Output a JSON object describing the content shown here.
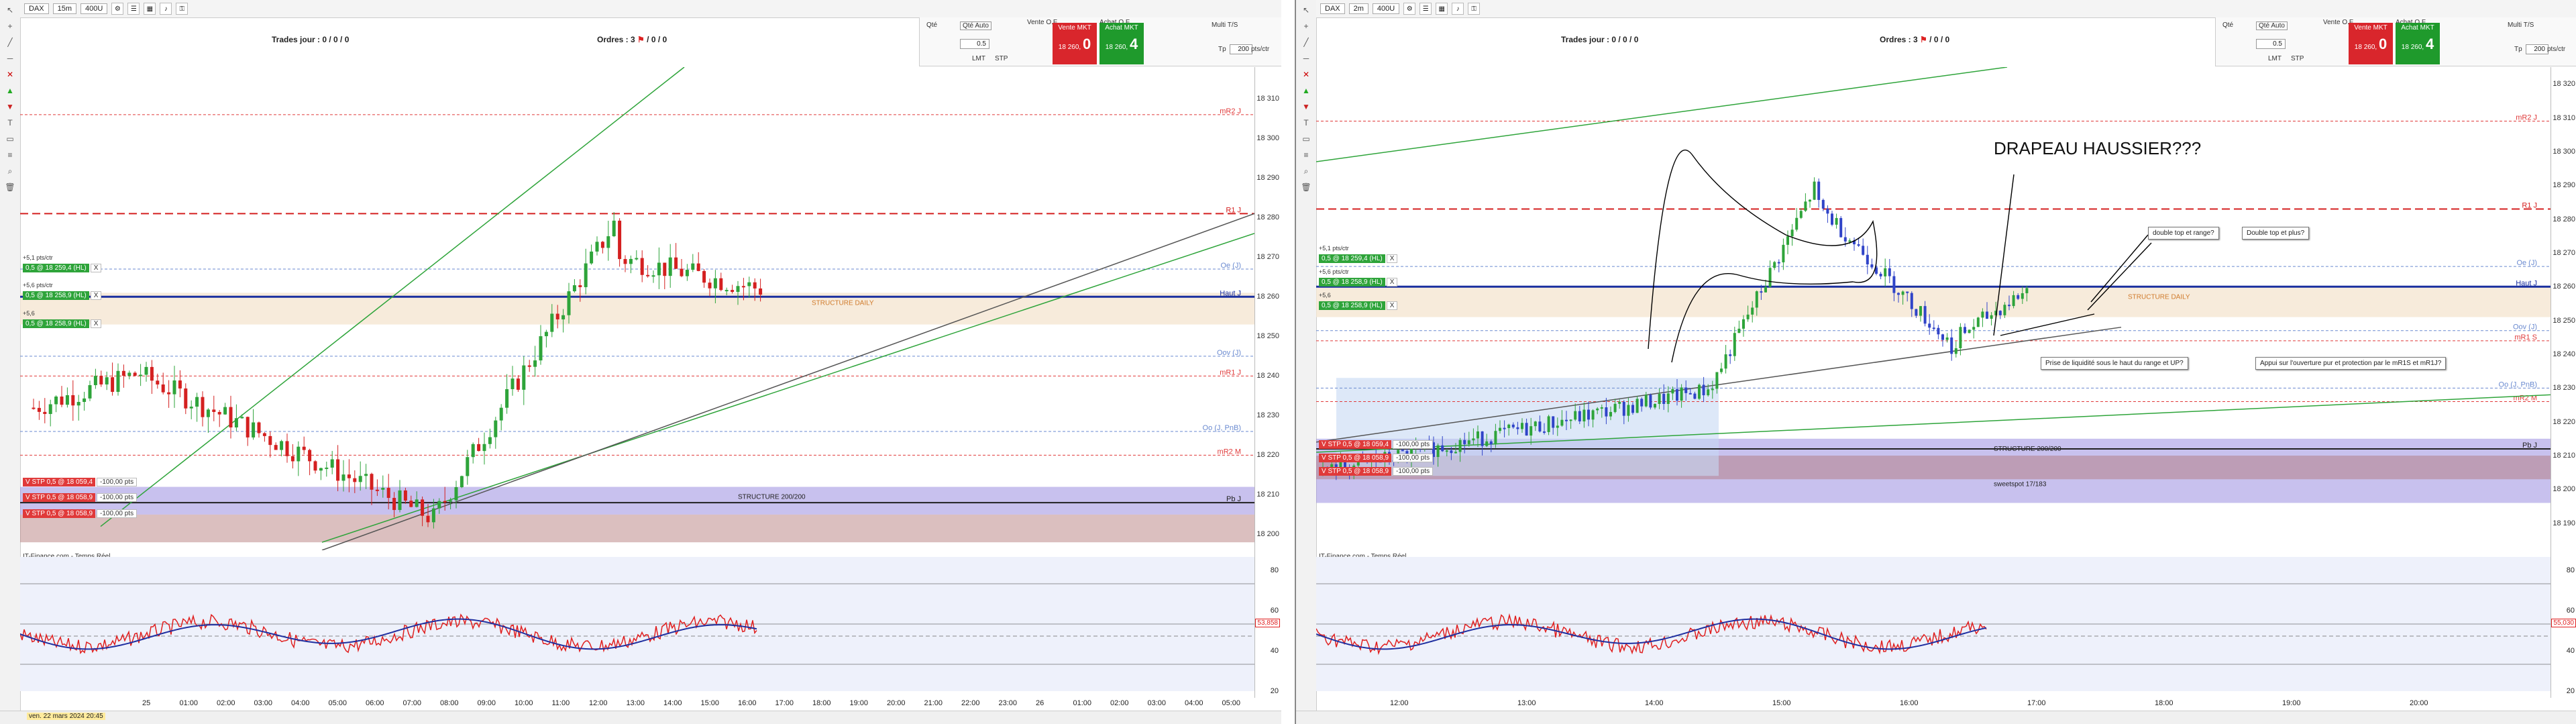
{
  "left": {
    "toolbar": {
      "symbol": "DAX",
      "timeframe": "15m",
      "ticks": "400U"
    },
    "trades_jour": "Trades jour : 0 / 0 / 0",
    "ordres": "Ordres : 3",
    "ordres_suffix": "/ 0 / 0",
    "order_panel": {
      "qty_label": "Qté",
      "qty_auto": "Qté Auto",
      "qty_value": "0.5",
      "lmt": "LMT",
      "stp": "STP",
      "vente_of": "Vente O.F.",
      "achat_of": "Achat O.F.",
      "vente_mkt": "Vente MKT",
      "achat_mkt": "Achat MKT",
      "sell_price": "18 260,",
      "sell_qty": "0",
      "buy_price": "18 260,",
      "buy_qty": "4",
      "multi_tp": "Multi T/S",
      "tp_label": "Tp",
      "tp_value": "200",
      "pts": "pts/ctr"
    },
    "price_scale": [
      "18 310",
      "18 300",
      "18 290",
      "18 280",
      "18 270",
      "18 260",
      "18 250",
      "18 240",
      "18 230",
      "18 220",
      "18 210",
      "18 200"
    ],
    "levels": {
      "mr2_j": "mR2 J",
      "r1_j": "R1 J",
      "oe_u": "Oe (J)",
      "hausd": "Haut J",
      "oov": "Oov (J)",
      "mr1_j": "mR1 J",
      "mr1s": "mR1 S",
      "oo_pnb": "Oo (J, PnB)",
      "mr2_m": "mR2 M",
      "pb_j": "Pb J",
      "structure_daily": "STRUCTURE DAILY",
      "structure_200": "STRUCTURE 200/200"
    },
    "positions": [
      {
        "qty": "0,5",
        "at": "@",
        "price": "18 259,4",
        "tag": "(HL)",
        "sub": "+5,1 pts/ctr"
      },
      {
        "qty": "0,5",
        "at": "@",
        "price": "18 258,9",
        "tag": "(HL)",
        "sub": "+5,6 pts/ctr"
      },
      {
        "qty": "0,5",
        "at": "@",
        "price": "18 258,9",
        "tag": "(HL)",
        "sub": "+5,6"
      }
    ],
    "stops": [
      {
        "text": "V STP 0,5 @ 18 059,4",
        "pnl": "-100,00 pts"
      },
      {
        "text": "V STP 0,5 @ 18 058,9",
        "pnl": "-100,00 pts"
      },
      {
        "text": "V STP 0,5 @ 18 058,9",
        "pnl": "-100,00 pts"
      }
    ],
    "source": "IT-Finance.com - Temps Réel",
    "time_labels": [
      "25",
      "01:00",
      "02:00",
      "03:00",
      "04:00",
      "05:00",
      "06:00",
      "07:00",
      "08:00",
      "09:00",
      "10:00",
      "11:00",
      "12:00",
      "13:00",
      "14:00",
      "15:00",
      "16:00",
      "17:00",
      "18:00",
      "19:00",
      "20:00",
      "21:00",
      "22:00",
      "23:00",
      "26",
      "01:00",
      "02:00",
      "03:00",
      "04:00",
      "05:00"
    ],
    "ind_scale": [
      "80",
      "60",
      "40",
      "20"
    ],
    "ind_value": "53,858",
    "date_label": "ven. 22 mars 2024 20:45"
  },
  "right": {
    "toolbar": {
      "symbol": "DAX",
      "timeframe": "2m",
      "ticks": "400U"
    },
    "trades_jour": "Trades jour : 0 / 0 / 0",
    "ordres": "Ordres : 3",
    "ordres_suffix": "/ 0 / 0",
    "order_panel": {
      "qty_label": "Qté",
      "qty_auto": "Qté Auto",
      "qty_value": "0.5",
      "lmt": "LMT",
      "stp": "STP",
      "vente_of": "Vente O.F.",
      "achat_of": "Achat O.F.",
      "vente_mkt": "Vente MKT",
      "achat_mkt": "Achat MKT",
      "sell_price": "18 260,",
      "sell_qty": "0",
      "buy_price": "18 260,",
      "buy_qty": "4",
      "multi_tp": "Multi T/S",
      "tp_label": "Tp",
      "tp_value": "200",
      "pts": "pts/ctr"
    },
    "price_scale": [
      "18 320",
      "18 310",
      "18 300",
      "18 290",
      "18 280",
      "18 270",
      "18 260",
      "18 250",
      "18 240",
      "18 230",
      "18 220",
      "18 210",
      "18 200",
      "18 190"
    ],
    "title_note": "DRAPEAU HAUSSIER???",
    "callouts": [
      "double top et range?",
      "Double top et plus?",
      "Prise de liquidité sous le haut du range et UP?",
      "Appui sur l'ouverture pur et protection par le mR1S et mR1J?"
    ],
    "levels": {
      "mr2_j": "mR2 J",
      "r1_j": "R1 J",
      "oe_u": "Oe (J)",
      "hausd": "Haut J",
      "oov": "Oov (J)",
      "mr1s": "mR1 S",
      "oo_pnb": "Oo (J, PnB)",
      "mr2_m": "mR2 M",
      "pb_j": "Pb J",
      "structure_daily": "STRUCTURE DAILY",
      "structure_200": "STRUCTURE 200/200",
      "sweetspot": "sweetspot 17/183",
      "mr1_j": "mR1 J"
    },
    "positions": [
      {
        "qty": "0,5",
        "at": "@",
        "price": "18 259,4",
        "tag": "(HL)",
        "sub": "+5,1 pts/ctr"
      },
      {
        "qty": "0,5",
        "at": "@",
        "price": "18 258,9",
        "tag": "(HL)",
        "sub": "+5,6 pts/ctr"
      },
      {
        "qty": "0,5",
        "at": "@",
        "price": "18 258,9",
        "tag": "(HL)",
        "sub": "+5,6"
      }
    ],
    "stops": [
      {
        "text": "V STP 0,5 @ 18 059,4",
        "pnl": "-100,00 pts"
      },
      {
        "text": "V STP 0,5 @ 18 058,9",
        "pnl": "-100,00 pts"
      },
      {
        "text": "V STP 0,5 @ 18 058,9",
        "pnl": "-100,00 pts"
      }
    ],
    "source": "IT-Finance.com - Temps Réel",
    "time_labels": [
      "12:00",
      "13:00",
      "14:00",
      "15:00",
      "16:00",
      "17:00",
      "18:00",
      "19:00",
      "20:00"
    ],
    "ind_scale": [
      "80",
      "60",
      "40",
      "20"
    ],
    "ind_value": "55,030"
  },
  "colors": {
    "up": "#2ea43a",
    "down": "#3044c8",
    "sell": "#d9262c",
    "buy": "#1f9a2c"
  }
}
